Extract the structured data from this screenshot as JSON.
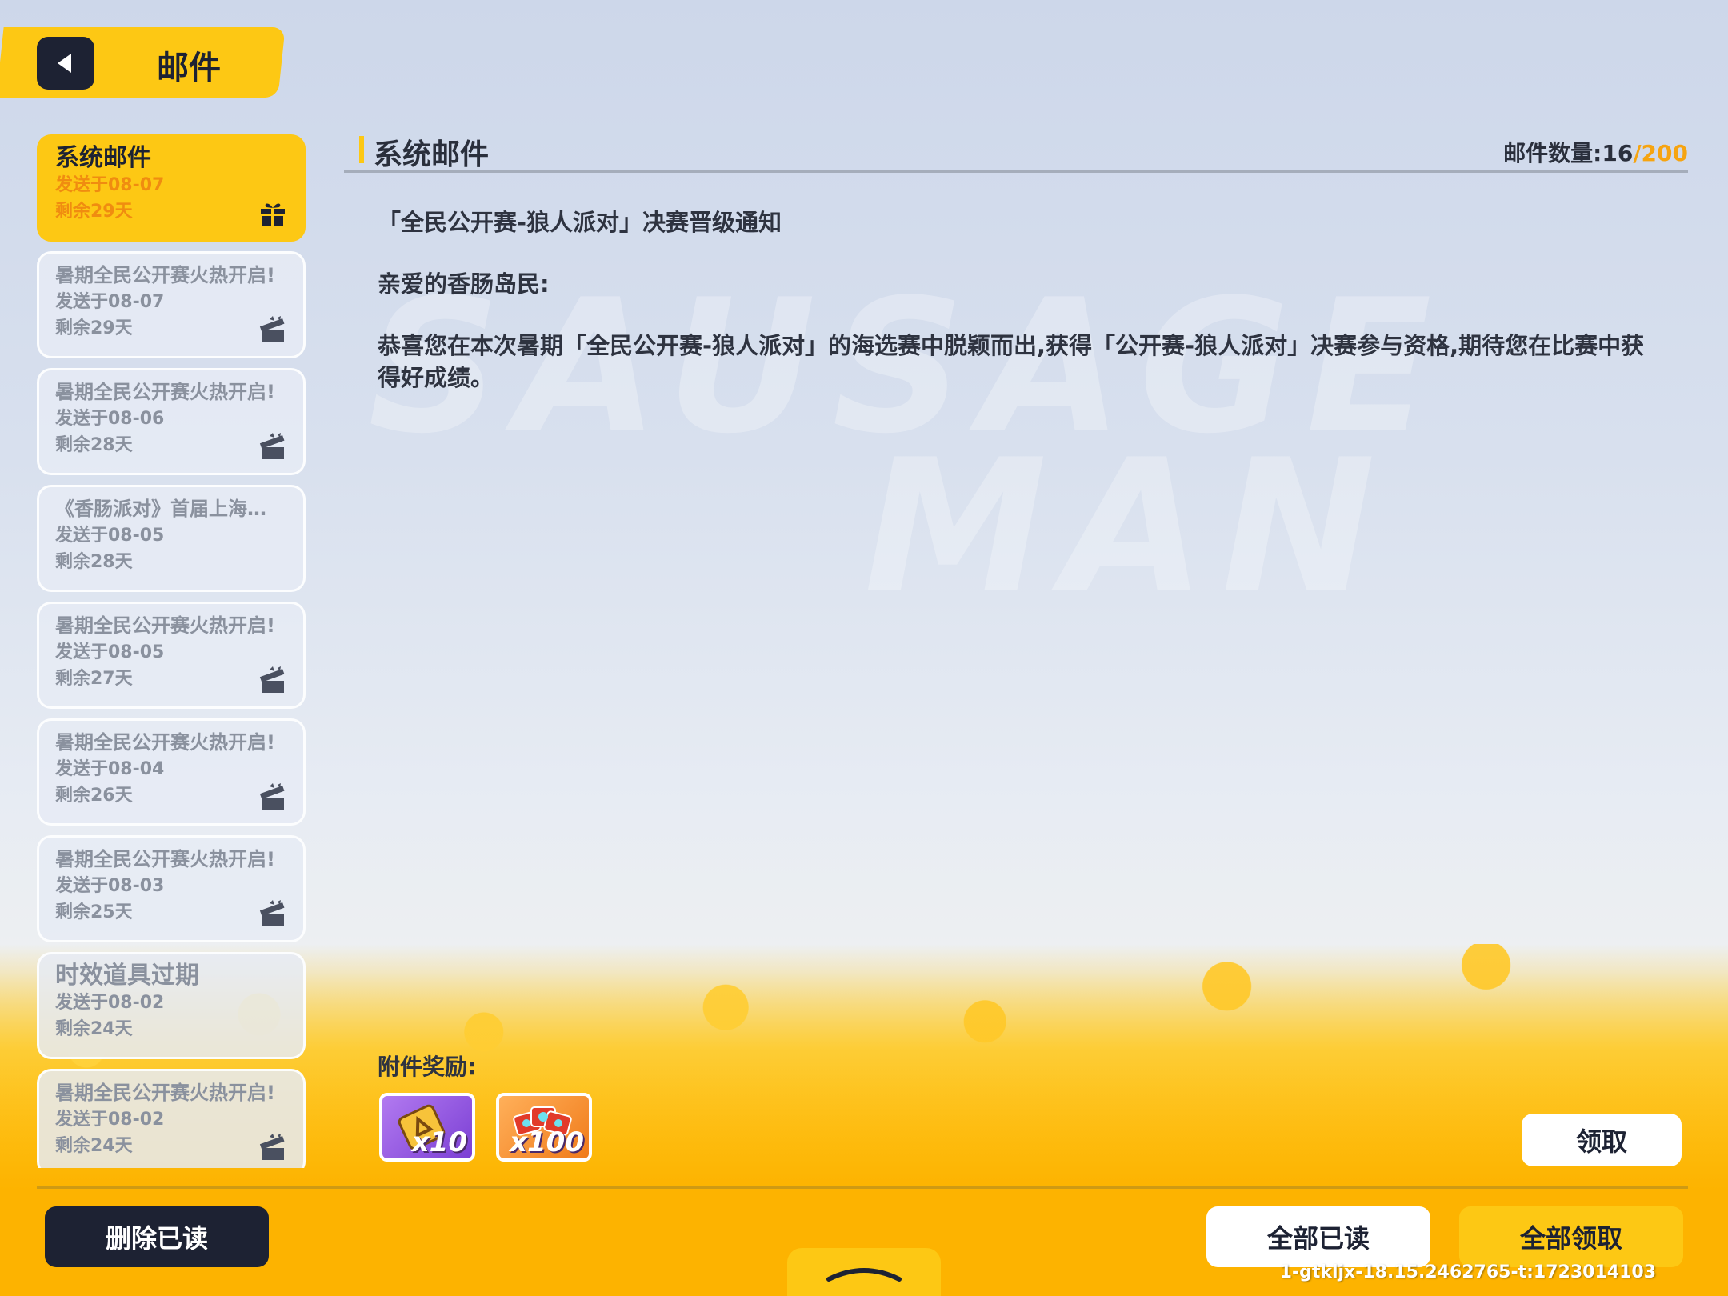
{
  "header": {
    "title": "邮件"
  },
  "mail_list": [
    {
      "title": "系统邮件",
      "date": "发送于08-07",
      "remaining": "剩余29天",
      "has_gift": true,
      "active": true
    },
    {
      "title": "暑期全民公开赛火热开启!",
      "date": "发送于08-07",
      "remaining": "剩余29天",
      "has_gift": true
    },
    {
      "title": "暑期全民公开赛火热开启!",
      "date": "发送于08-06",
      "remaining": "剩余28天",
      "has_gift": true
    },
    {
      "title": "《香肠派对》首届上海…",
      "date": "发送于08-05",
      "remaining": "剩余28天",
      "has_gift": false
    },
    {
      "title": "暑期全民公开赛火热开启!",
      "date": "发送于08-05",
      "remaining": "剩余27天",
      "has_gift": true
    },
    {
      "title": "暑期全民公开赛火热开启!",
      "date": "发送于08-04",
      "remaining": "剩余26天",
      "has_gift": true
    },
    {
      "title": "暑期全民公开赛火热开启!",
      "date": "发送于08-03",
      "remaining": "剩余25天",
      "has_gift": true
    },
    {
      "title": "时效道具过期",
      "date": "发送于08-02",
      "remaining": "剩余24天",
      "has_gift": false
    },
    {
      "title": "暑期全民公开赛火热开启!",
      "date": "发送于08-02",
      "remaining": "剩余24天",
      "has_gift": true
    }
  ],
  "content": {
    "title": "系统邮件",
    "count_label": "邮件数量:",
    "count_current": "16",
    "count_max": "/200",
    "subject": "「全民公开赛-狼人派对」决赛晋级通知",
    "greeting": "亲爱的香肠岛民:",
    "body": "恭喜您在本次暑期「全民公开赛-狼人派对」的海选赛中脱颖而出,获得「公开赛-狼人派对」决赛参与资格,期待您在比赛中获得好成绩。",
    "attachment_label": "附件奖励:",
    "rewards": [
      {
        "icon": "ticket-icon",
        "qty": "x10"
      },
      {
        "icon": "gem-cards-icon",
        "qty": "x100"
      }
    ]
  },
  "buttons": {
    "claim": "领取",
    "delete_read": "删除已读",
    "read_all": "全部已读",
    "claim_all": "全部领取"
  },
  "watermark": {
    "line1": "SAUSAGE",
    "line2": "MAN"
  },
  "version": "1-gtkljx-18.15.2462765-t:1723014103",
  "colors": {
    "accent": "#fdc814",
    "dark": "#1d2233",
    "count_max": "#f6a410"
  }
}
